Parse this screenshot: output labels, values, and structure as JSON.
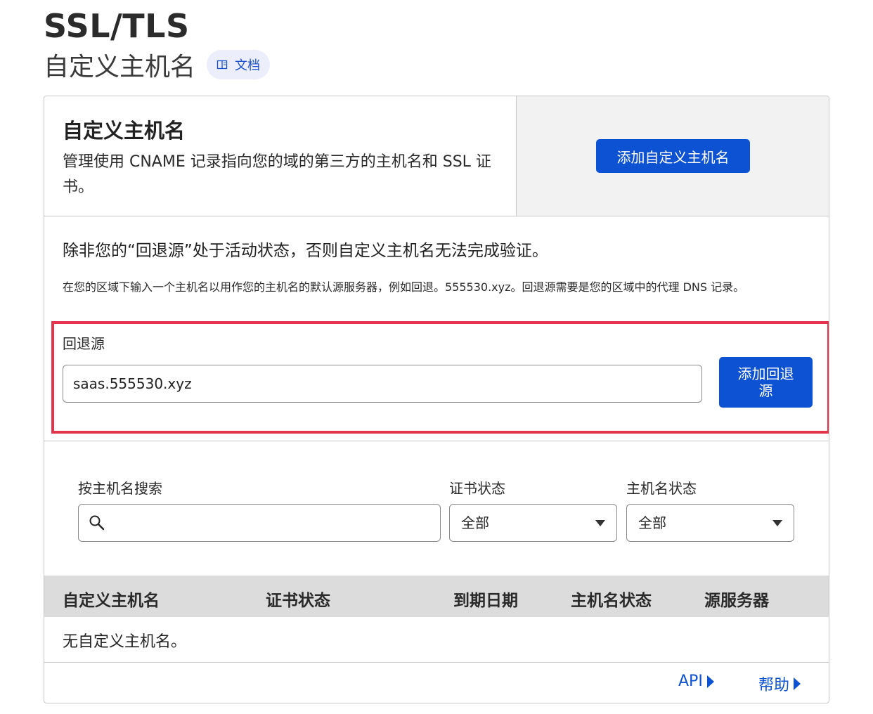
{
  "header": {
    "title": "SSL/TLS",
    "subtitle": "自定义主机名",
    "docs_label": "文档"
  },
  "card": {
    "title": "自定义主机名",
    "description": "管理使用 CNAME 记录指向您的域的第三方的主机名和 SSL 证书。",
    "add_hostname_label": "添加自定义主机名",
    "warning": "除非您的“回退源”处于活动状态，否则自定义主机名无法完成验证。",
    "info": "在您的区域下输入一个主机名以用作您的主机名的默认源服务器，例如回退。555530.xyz。回退源需要是您的区域中的代理 DNS 记录。"
  },
  "fallback": {
    "label": "回退源",
    "value": "saas.555530.xyz",
    "button_label": "添加回退源"
  },
  "filters": {
    "search_label": "按主机名搜索",
    "search_value": "",
    "cert_status_label": "证书状态",
    "cert_status_value": "全部",
    "hostname_status_label": "主机名状态",
    "hostname_status_value": "全部"
  },
  "table": {
    "columns": [
      "自定义主机名",
      "证书状态",
      "到期日期",
      "主机名状态",
      "源服务器"
    ],
    "empty_message": "无自定义主机名。"
  },
  "footer": {
    "api_label": "API",
    "help_label": "帮助"
  },
  "colors": {
    "primary": "#0d52d3",
    "highlight": "#e5334b"
  }
}
